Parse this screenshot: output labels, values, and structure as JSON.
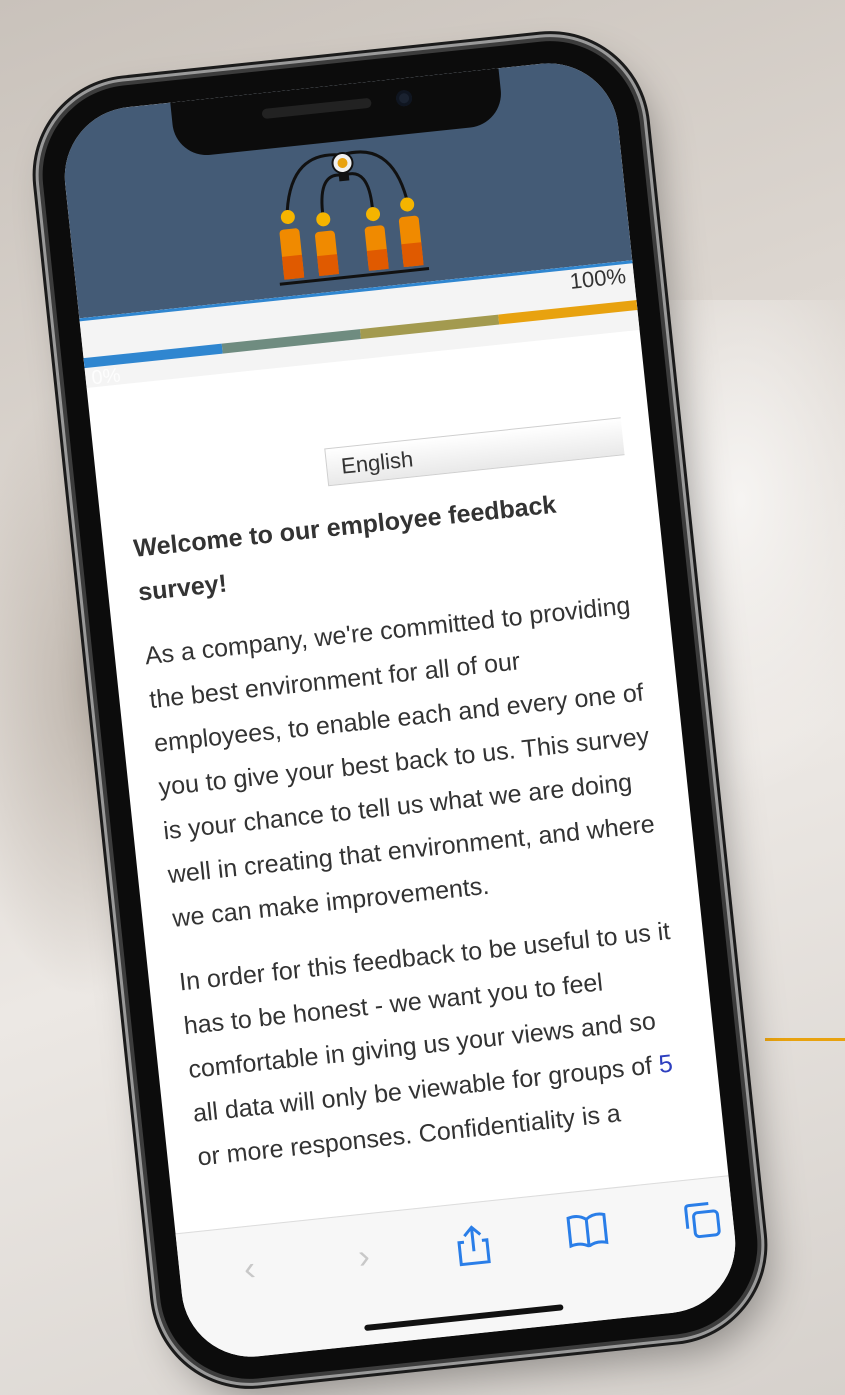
{
  "progress": {
    "top_label": "100%",
    "bottom_label": "0%",
    "value": 1.0,
    "segment_colors": [
      "#2f86d0",
      "#6f8c80",
      "#a39a4f",
      "#e8a20f"
    ]
  },
  "language": {
    "selected": "English"
  },
  "survey": {
    "welcome_title": "Welcome to our employee feedback survey!",
    "paragraph1": "As a company, we're committed to providing the best environment for all of our employees, to enable each and every one of you to give your best back to us. This survey is your chance to tell us what we are doing well in creating that environment, and where we can make improvements.",
    "paragraph2_before": "In order for this feedback to be useful to us it has to be honest - we want you to feel comfortable in giving us your views and so all data will only be viewable for groups of ",
    "paragraph2_number": "5",
    "paragraph2_after": " or more responses. Confidentiality is a"
  },
  "toolbar": {
    "back_icon": "chevron-left-icon",
    "forward_icon": "chevron-right-icon",
    "share_icon": "share-icon",
    "bookmarks_icon": "book-icon",
    "tabs_icon": "tabs-icon"
  },
  "colors": {
    "header": "#445b76",
    "accent_orange": "#e8a20f",
    "link_blue": "#2d3fbf"
  }
}
